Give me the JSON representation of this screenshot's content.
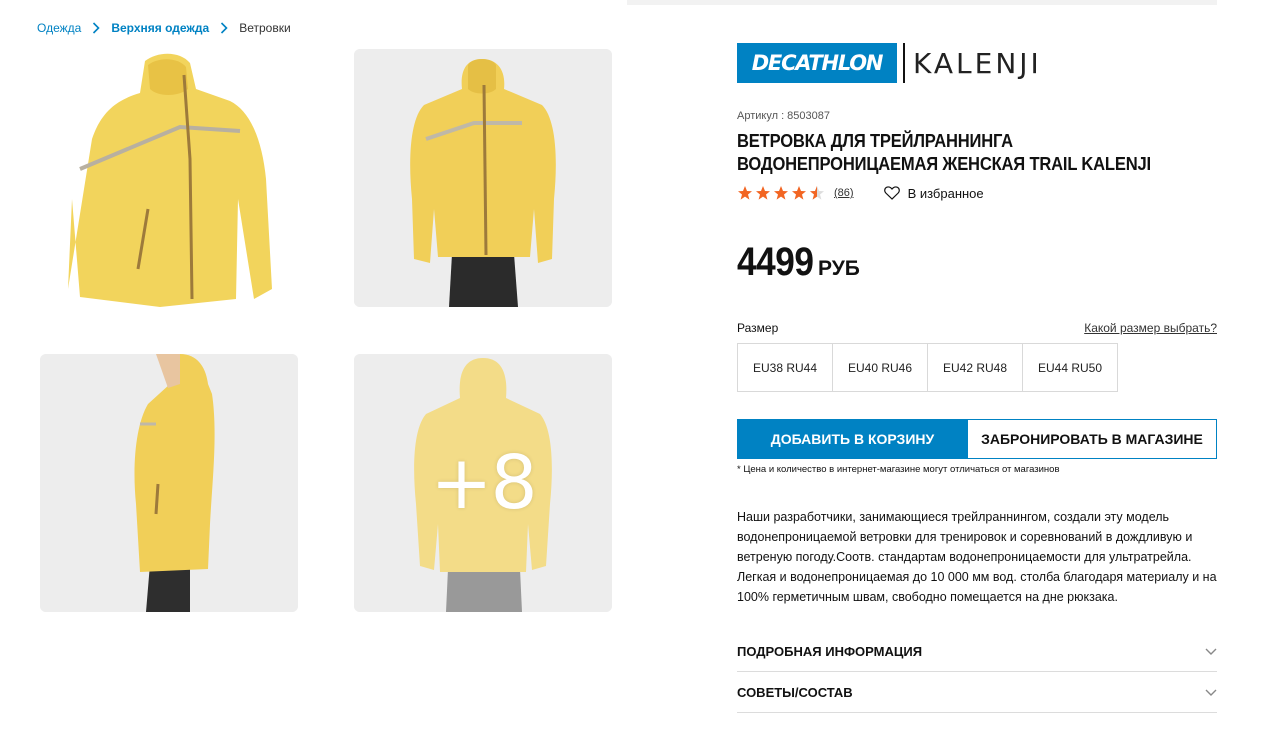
{
  "breadcrumb": {
    "items": [
      "Одежда",
      "Верхняя одежда"
    ],
    "current": "Ветровки"
  },
  "gallery": {
    "more_label": "+8",
    "jacket_color": "#f2d16b"
  },
  "brand": {
    "decathlon": "DECATHLON",
    "kalenji": "KALENJI"
  },
  "product": {
    "sku": "Артикул : 8503087",
    "title_line1": "ВЕТРОВКА ДЛЯ ТРЕЙЛРАННИНГА",
    "title_line2": "ВОДОНЕПРОНИЦАЕМАЯ ЖЕНСКАЯ TRAIL KALENJI",
    "rating": 4.5,
    "reviews": "(86)",
    "favorite": "В избранное",
    "price": "4499",
    "currency": "РУБ"
  },
  "size": {
    "label": "Размер",
    "guide": "Какой размер выбрать?",
    "options": [
      "EU38 RU44",
      "EU40 RU46",
      "EU42 RU48",
      "EU44 RU50"
    ]
  },
  "actions": {
    "cart": "ДОБАВИТЬ В КОРЗИНУ",
    "reserve": "ЗАБРОНИРОВАТЬ В МАГАЗИНЕ",
    "note": "* Цена и количество в интернет-магазине могут отличаться от магазинов"
  },
  "description": "Наши разработчики, занимающиеся трейлраннингом, создали эту модель водонепроницаемой ветровки для тренировок и соревнований в дождливую и ветреную погоду.Соотв. стандартам водонепроницаемости для ультратрейла. Легкая и водонепроницаемая до 10 000 мм вод. столба благодаря материалу и на 100% герметичным швам, свободно помещается на дне рюкзака.",
  "accordion": [
    "ПОДРОБНАЯ ИНФОРМАЦИЯ",
    "СОВЕТЫ/СОСТАВ"
  ],
  "colors": {
    "accent": "#0082c3",
    "star": "#f26522"
  }
}
